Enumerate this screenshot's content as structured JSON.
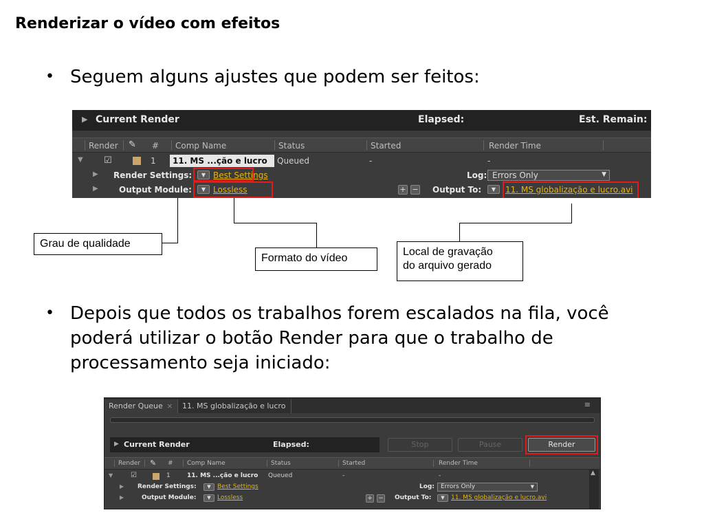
{
  "title": "Renderizar o vídeo com efeitos",
  "bullets": [
    "Seguem alguns ajustes que podem ser feitos:",
    "Depois que todos os trabalhos forem escalados na fila, você poderá utilizar o botão Render para que o trabalho de processamento seja iniciado:"
  ],
  "panel": {
    "current_render": "Current Render",
    "elapsed": "Elapsed:",
    "est_remain": "Est. Remain:",
    "columns": {
      "render": "Render",
      "num": "#",
      "comp_name": "Comp Name",
      "status": "Status",
      "started": "Started",
      "render_time": "Render Time"
    },
    "item": {
      "num": "1",
      "name": "11. MS ...ção e lucro",
      "status": "Queued",
      "started": "-",
      "render_time": "-"
    },
    "render_settings_label": "Render Settings:",
    "render_settings_value": "Best Settings",
    "output_module_label": "Output Module:",
    "output_module_value": "Lossless",
    "log_label": "Log:",
    "log_value": "Errors Only",
    "output_to_label": "Output To:",
    "output_to_value": "11. MS globalização e lucro.avi"
  },
  "callouts": {
    "quality": "Grau de qualidade",
    "format": "Formato do vídeo",
    "location_1": "Local de gravação",
    "location_2": "do arquivo gerado"
  },
  "queue": {
    "tab_render_queue": "Render Queue",
    "tab_comp": "11. MS globalização e lucro",
    "stop": "Stop",
    "pause": "Pause",
    "render": "Render"
  },
  "colors": {
    "highlight": "#e01b1b",
    "link_yellow": "#e8b600",
    "panel_bg": "#3b3b3b"
  }
}
